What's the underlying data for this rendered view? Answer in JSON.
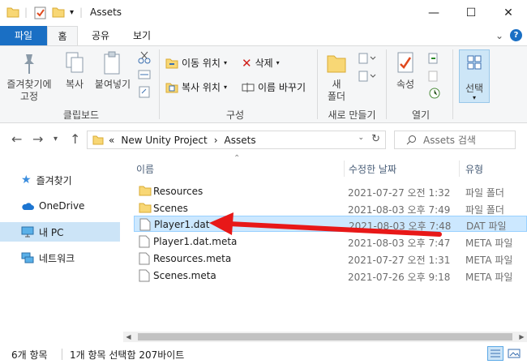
{
  "window": {
    "title": "Assets",
    "controls": {
      "minimize": "—",
      "maximize": "☐",
      "close": "✕"
    }
  },
  "ribbon_tabs": {
    "file": "파일",
    "home": "홈",
    "share": "공유",
    "view": "보기",
    "expand": "⌄",
    "help": "?"
  },
  "ribbon": {
    "pin_quick_access": "즐겨찾기에\n고정",
    "copy": "복사",
    "paste": "붙여넣기",
    "clipboard_group": "클립보드",
    "move_to": "이동 위치",
    "copy_to": "복사 위치",
    "delete": "삭제",
    "rename": "이름 바꾸기",
    "organize_group": "구성",
    "new_folder": "새\n폴더",
    "new_group": "새로 만들기",
    "properties": "속성",
    "open_group": "열기",
    "select": "선택"
  },
  "address_bar": {
    "overflow": "«",
    "crumbs": [
      "New Unity Project",
      "Assets"
    ],
    "separator": "›",
    "search_placeholder": "Assets 검색"
  },
  "nav_pane": {
    "items": [
      {
        "label": "즐겨찾기",
        "icon": "star-icon"
      },
      {
        "label": "OneDrive",
        "icon": "cloud-icon"
      },
      {
        "label": "내 PC",
        "icon": "pc-icon"
      },
      {
        "label": "네트워크",
        "icon": "network-icon"
      }
    ]
  },
  "file_list": {
    "columns": {
      "name": "이름",
      "date": "수정한 날짜",
      "type": "유형"
    },
    "rows": [
      {
        "name": "Resources",
        "date": "2021-07-27 오전 1:32",
        "type": "파일 폴더",
        "kind": "folder"
      },
      {
        "name": "Scenes",
        "date": "2021-08-03 오후 7:49",
        "type": "파일 폴더",
        "kind": "folder"
      },
      {
        "name": "Player1.dat",
        "date": "2021-08-03 오후 7:48",
        "type": "DAT 파일",
        "kind": "file"
      },
      {
        "name": "Player1.dat.meta",
        "date": "2021-08-03 오후 7:47",
        "type": "META 파일",
        "kind": "file"
      },
      {
        "name": "Resources.meta",
        "date": "2021-07-27 오전 1:31",
        "type": "META 파일",
        "kind": "file"
      },
      {
        "name": "Scenes.meta",
        "date": "2021-07-26 오후 9:18",
        "type": "META 파일",
        "kind": "file"
      }
    ]
  },
  "status": {
    "item_count": "6개 항목",
    "selection": "1개 항목 선택함 207바이트"
  },
  "colors": {
    "accent": "#1a6fc4",
    "selected_row": "#cce8ff",
    "arrow": "#e81818",
    "folder": "#f8d775"
  }
}
